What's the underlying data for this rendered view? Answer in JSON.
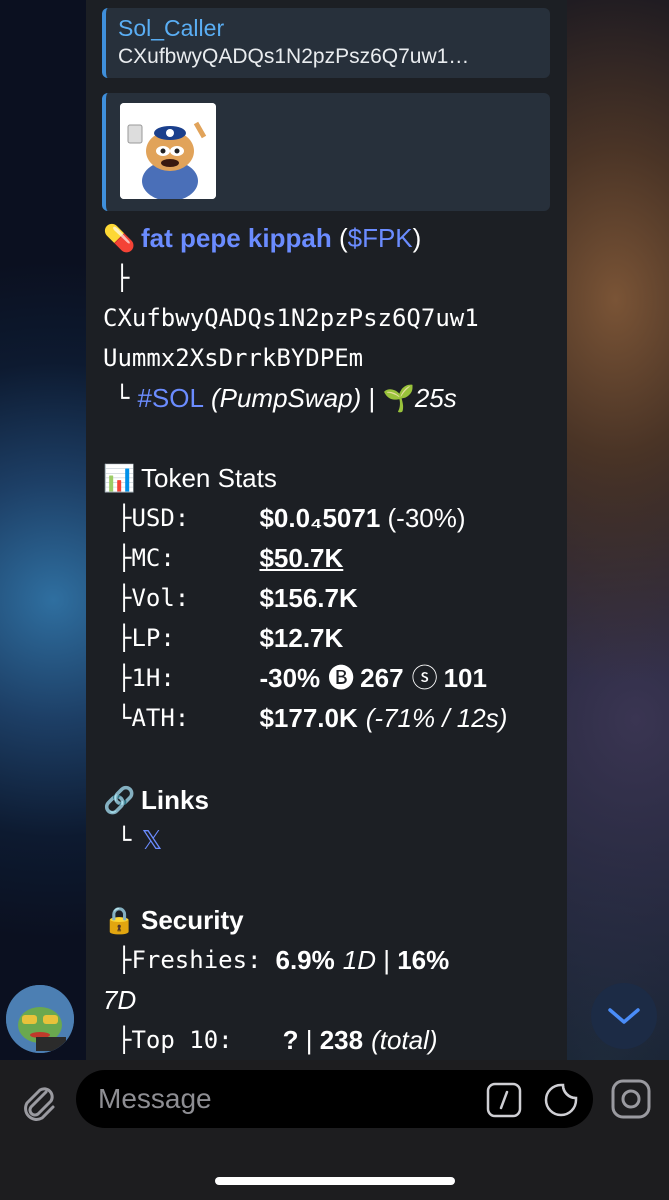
{
  "reply": {
    "name": "Sol_Caller",
    "text": "CXufbwyQADQs1N2pzPsz6Q7uw1…"
  },
  "token": {
    "pill": "💊",
    "name": "fat pepe kippah",
    "paren_open": "(",
    "ticker": "$FPK",
    "paren_close": ")",
    "branch": "├",
    "address_1": "CXufbwyQADQs1N2pzPsz6Q7uw1",
    "address_2": "Uummx2XsDrrkBYDPEm",
    "end_branch": "└",
    "chain": "#SOL",
    "dex": "(PumpSwap)",
    "sep": " | ",
    "seedling": "🌱",
    "age": "25s"
  },
  "stats": {
    "icon": "📊",
    "title": "Token Stats",
    "rows": [
      {
        "branch": "├",
        "label": "USD:",
        "value": "$0.0₄5071",
        "extra": " (-30%)"
      },
      {
        "branch": "├",
        "label": "MC:",
        "value": "$50.7K",
        "extra": ""
      },
      {
        "branch": "├",
        "label": "Vol:",
        "value": "$156.7K",
        "extra": ""
      },
      {
        "branch": "├",
        "label": "LP:",
        "value": "$12.7K",
        "extra": ""
      },
      {
        "branch": "├",
        "label": "1H:",
        "value": "-30%",
        "buys_icon": "🅑",
        "buys": "267",
        "sells_icon": "ⓢ",
        "sells": "101"
      },
      {
        "branch": "└",
        "label": "ATH:",
        "value": "$177.0K",
        "extra": "(-71% / 12s)"
      }
    ]
  },
  "links": {
    "icon": "🔗",
    "title": "Links",
    "branch": "└",
    "x": "𝕏"
  },
  "security": {
    "icon": "🔒",
    "title": "Security",
    "freshies_branch": "├",
    "freshies_label": "Freshies:",
    "freshies_1d": "6.9%",
    "freshies_1d_unit": "1D",
    "freshies_sep": " | ",
    "freshies_7d": "16%",
    "freshies_7d_unit": "7D",
    "top10_branch": "├",
    "top10_label": "Top 10:",
    "top10_value": "?",
    "top10_sep": " | ",
    "top10_total": "238",
    "top10_total_label": "(total)"
  },
  "composer": {
    "placeholder": "Message"
  },
  "colors": {
    "link_blue": "#6b8cff",
    "reply_accent": "#3f8fdb",
    "bubble_bg": "#1c1f24"
  }
}
